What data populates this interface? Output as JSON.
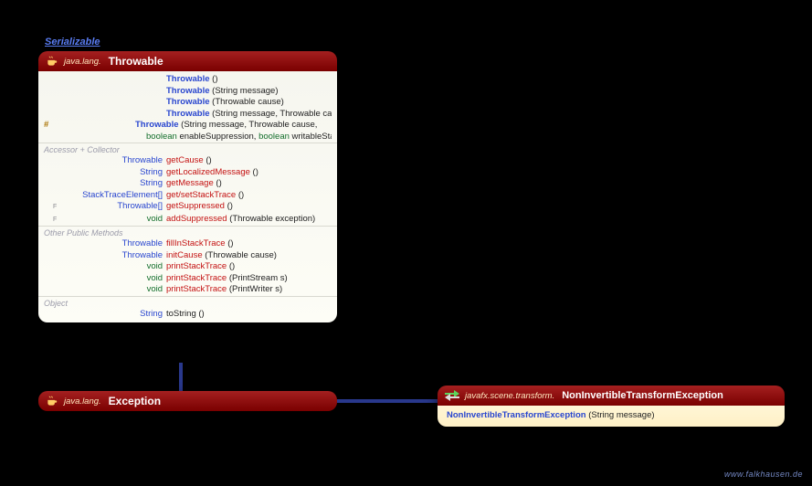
{
  "implementsLabel": "Serializable",
  "watermark": "www.falkhausen.de",
  "throwable": {
    "header": {
      "package": "java.lang.",
      "classname": "Throwable"
    },
    "constructors": [
      {
        "mod": "",
        "name": "Throwable",
        "params": "()"
      },
      {
        "mod": "",
        "name": "Throwable",
        "params": "(String message)"
      },
      {
        "mod": "",
        "name": "Throwable",
        "params": "(Throwable cause)"
      },
      {
        "mod": "",
        "name": "Throwable",
        "params": "(String message, Throwable cause)"
      },
      {
        "mod": "#",
        "name": "Throwable",
        "params_line1": "(String message, Throwable cause,",
        "params_line2_types": [
          "boolean",
          " enableSuppression, ",
          "boolean",
          " writableStackTrace)"
        ]
      }
    ],
    "sections": {
      "accessor": {
        "label": "Accessor + Collector",
        "rows": [
          {
            "ret": "Throwable",
            "retType": "blue",
            "name": "getCause",
            "params": "()"
          },
          {
            "ret": "String",
            "retType": "blue",
            "name": "getLocalizedMessage",
            "params": "()"
          },
          {
            "ret": "String",
            "retType": "blue",
            "name": "getMessage",
            "params": "()"
          },
          {
            "ret": "StackTraceElement[]",
            "retType": "blue",
            "name": "get/setStackTrace",
            "params": "()"
          },
          {
            "flag": "F",
            "ret": "Throwable[]",
            "retType": "blue",
            "name": "getSuppressed",
            "params": "()"
          },
          {
            "flag": "F",
            "ret": "void",
            "retType": "green",
            "name": "addSuppressed",
            "params": "(Throwable exception)"
          }
        ]
      },
      "other": {
        "label": "Other Public Methods",
        "rows": [
          {
            "ret": "Throwable",
            "retType": "blue",
            "name": "fillInStackTrace",
            "params": "()"
          },
          {
            "ret": "Throwable",
            "retType": "blue",
            "name": "initCause",
            "params": "(Throwable cause)"
          },
          {
            "ret": "void",
            "retType": "green",
            "name": "printStackTrace",
            "params": "()"
          },
          {
            "ret": "void",
            "retType": "green",
            "name": "printStackTrace",
            "params": "(PrintStream s)"
          },
          {
            "ret": "void",
            "retType": "green",
            "name": "printStackTrace",
            "params": "(PrintWriter s)"
          }
        ]
      },
      "object": {
        "label": "Object",
        "rows": [
          {
            "ret": "String",
            "retType": "blue",
            "name": "toString",
            "nameStyle": "black",
            "params": "()"
          }
        ]
      }
    }
  },
  "exception": {
    "header": {
      "package": "java.lang.",
      "classname": "Exception"
    }
  },
  "ninv": {
    "header": {
      "package": "javafx.scene.transform.",
      "classname": "NonInvertibleTransformException"
    },
    "ctor": {
      "name": "NonInvertibleTransformException",
      "params": "(String message)"
    }
  }
}
